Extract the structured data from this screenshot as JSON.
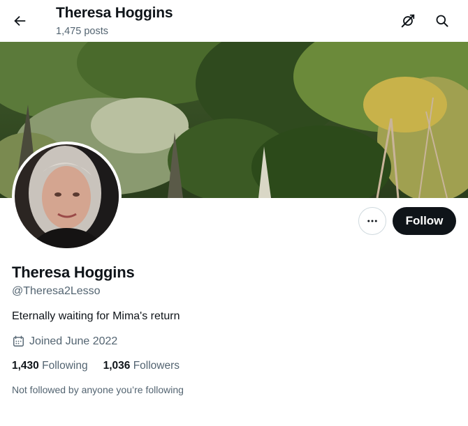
{
  "header": {
    "title": "Theresa Hoggins",
    "post_count": "1,475 posts",
    "back_icon": "arrow-left-icon",
    "grok_icon": "grok-icon",
    "search_icon": "search-icon"
  },
  "profile": {
    "display_name": "Theresa Hoggins",
    "handle": "@Theresa2Lesso",
    "bio": "Eternally waiting for Mima's return",
    "joined": "Joined June 2022",
    "joined_icon": "calendar-icon",
    "following_count": "1,430",
    "following_label": "Following",
    "followers_count": "1,036",
    "followers_label": "Followers",
    "not_followed_text": "Not followed by anyone you’re following"
  },
  "actions": {
    "more_icon": "more-icon",
    "follow_label": "Follow"
  },
  "colors": {
    "text_primary": "#0f1419",
    "text_secondary": "#536471",
    "follow_bg": "#0f1419",
    "border": "#cfd9de"
  }
}
